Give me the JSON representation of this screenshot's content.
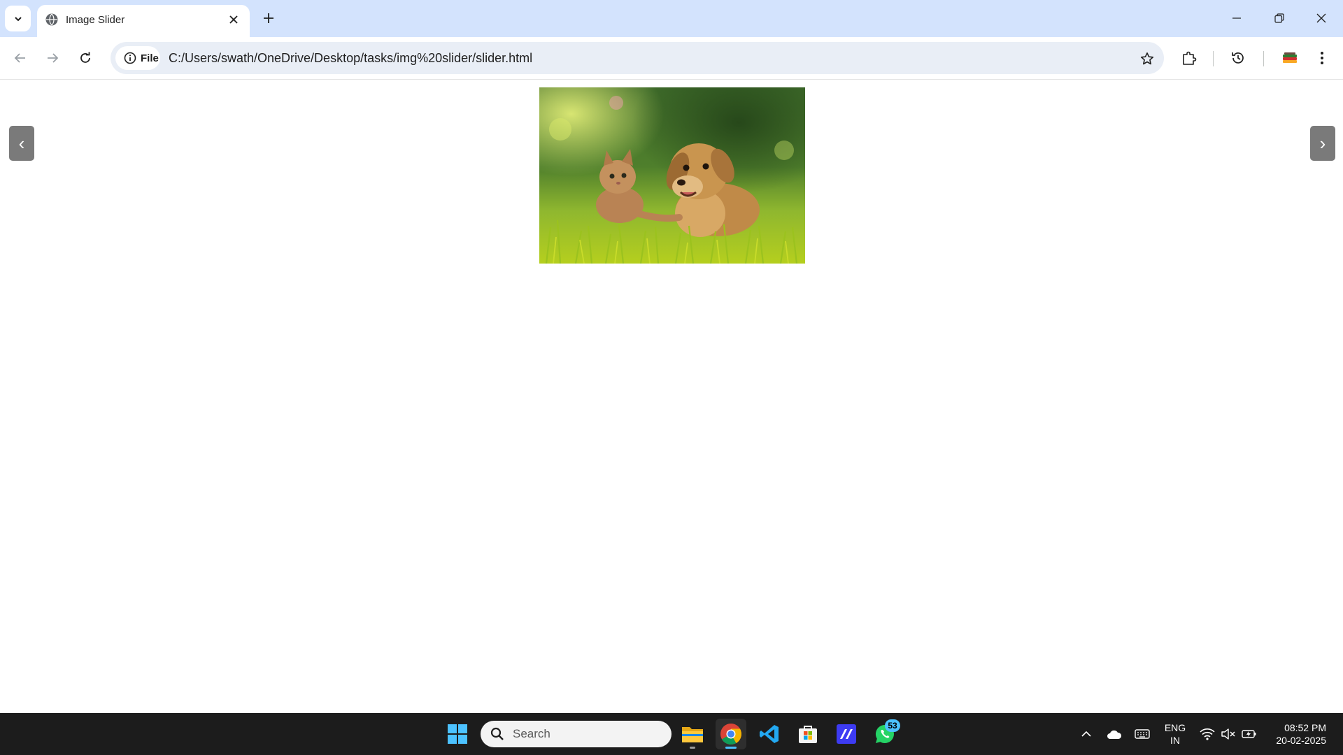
{
  "browser": {
    "tab": {
      "title": "Image Slider"
    },
    "address_bar": {
      "security_chip": "File",
      "url": "C:/Users/swath/OneDrive/Desktop/tasks/img%20slider/slider.html"
    }
  },
  "page": {
    "slider": {
      "prev_label": "‹",
      "next_label": "›",
      "image_alt": "Kitten and puppy sitting in the grass"
    }
  },
  "taskbar": {
    "search_placeholder": "Search",
    "whatsapp_badge": "53",
    "language": {
      "line1": "ENG",
      "line2": "IN"
    },
    "clock": {
      "time": "08:52 PM",
      "date": "20-02-2025"
    }
  },
  "colors": {
    "tabstrip": "#d3e3fd",
    "omnibox": "#e9eef6",
    "slider_button": "#7a7a7a",
    "taskbar": "#1c1c1c"
  }
}
